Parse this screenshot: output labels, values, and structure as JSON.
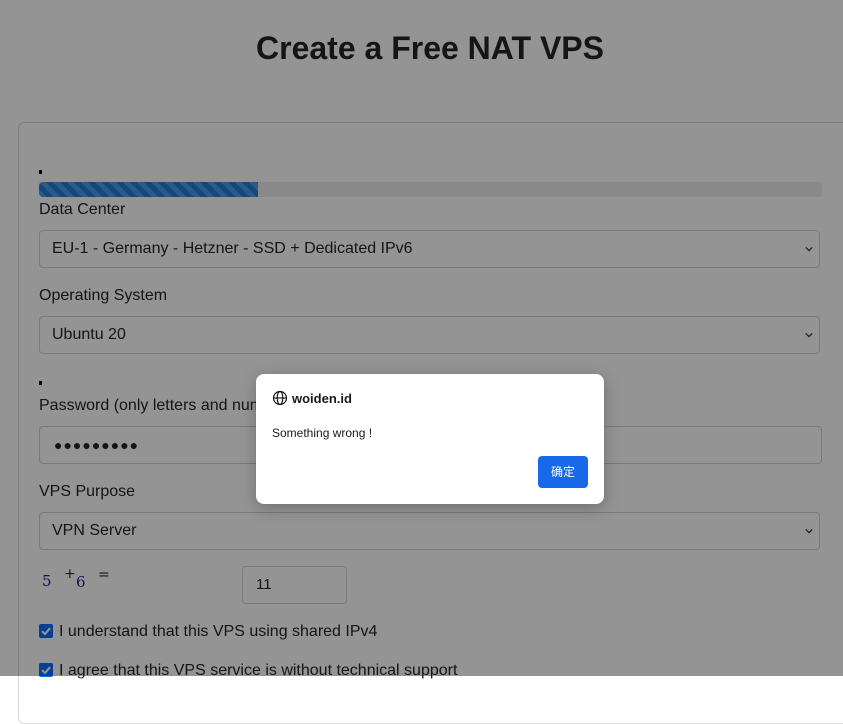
{
  "page": {
    "title": "Create a Free NAT VPS"
  },
  "form": {
    "progress_percent": 28,
    "data_center": {
      "label": "Data Center",
      "value": "EU-1 - Germany - Hetzner - SSD + Dedicated IPv6"
    },
    "operating_system": {
      "label": "Operating System",
      "value": "Ubuntu 20"
    },
    "password": {
      "label": "Password (only letters and num",
      "value": "●●●●●●●●●"
    },
    "vps_purpose": {
      "label": "VPS Purpose",
      "value": "VPN Server"
    },
    "captcha": {
      "a": "5",
      "op": "+",
      "b": "6",
      "eq": "=",
      "answer": "11"
    },
    "checkboxes": [
      {
        "label": "I understand that this VPS using shared IPv4",
        "checked": true
      },
      {
        "label": "I agree that this VPS service is without technical support",
        "checked": true
      }
    ]
  },
  "dialog": {
    "site": "woiden.id",
    "message": "Something wrong !",
    "ok_label": "确定"
  },
  "colors": {
    "accent": "#1769e8",
    "progress": "#1e7fdb",
    "checkbox": "#0d6efd"
  }
}
